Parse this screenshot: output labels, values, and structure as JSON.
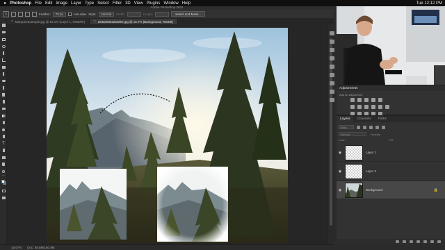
{
  "menubar": {
    "apple": "",
    "items": [
      "Photoshop",
      "File",
      "Edit",
      "Image",
      "Layer",
      "Type",
      "Select",
      "Filter",
      "3D",
      "View",
      "Plugins",
      "Window",
      "Help"
    ],
    "clock": "Tue 12:12 PM"
  },
  "window": {
    "title": "Adobe Photoshop 2021"
  },
  "options_bar": {
    "feather_label": "Feather:",
    "feather_value": "70 px",
    "anti_alias_label": "Anti-alias",
    "style_label": "Style:",
    "style_value": "Normal",
    "width_label": "Width:",
    "height_label": "Height:",
    "select_mask_label": "Select and Mask..."
  },
  "tabs": [
    {
      "label": "MarqueeExample.jpg @ 16.1% (Layer 1, RGB/8#)",
      "active": false
    },
    {
      "label": "DMarkMeadowRE.jpg @ 16.7% (Background, RGB/8)",
      "active": true
    }
  ],
  "statusbar": {
    "zoom": "16.67%",
    "doc": "Doc: 68.6M/180.9M"
  },
  "adjustments": {
    "title": "Adjustments",
    "subtitle": "Add an adjustment"
  },
  "layers_panel": {
    "tabs": [
      "Layers",
      "Channels",
      "Paths"
    ],
    "kind_label": "Kind",
    "blend_mode": "Normal",
    "opacity_label": "Opacity:",
    "lock_label": "Lock:",
    "fill_label": "Fill:",
    "layers": [
      {
        "name": "Layer 1",
        "selected": false,
        "type": "transparent"
      },
      {
        "name": "Layer 2",
        "selected": false,
        "type": "transparent"
      },
      {
        "name": "Background",
        "selected": true,
        "type": "photo"
      }
    ]
  },
  "icons": {
    "home": "home-icon",
    "close": "close-icon",
    "visibility": "eye-icon",
    "lock": "lock-icon"
  }
}
